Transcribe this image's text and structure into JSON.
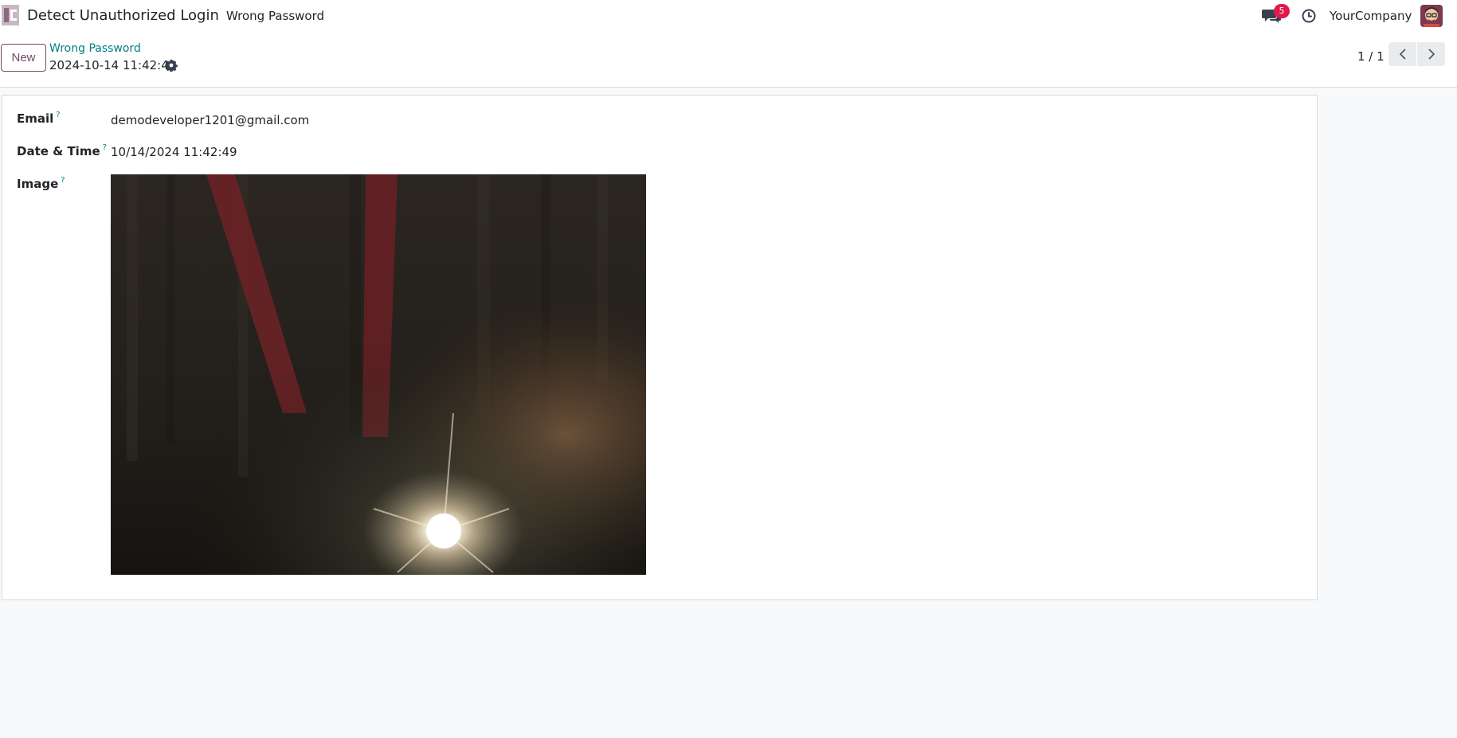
{
  "navbar": {
    "app_title": "Detect Unauthorized Login",
    "menu_item": "Wrong Password",
    "messages_count": "5",
    "company": "YourCompany"
  },
  "control": {
    "new_label": "New",
    "breadcrumb": "Wrong Password",
    "record_name": "2024-10-14 11:42:49",
    "pager_value": "1 / 1"
  },
  "form": {
    "email_label": "Email",
    "email_value": "demodeveloper1201@gmail.com",
    "datetime_label": "Date & Time",
    "datetime_value": "10/14/2024 11:42:49",
    "image_label": "Image",
    "help": "?"
  },
  "colors": {
    "brand": "#714b67",
    "link": "#017e84",
    "badge": "#e1194a"
  },
  "icons": [
    "app-icon",
    "chat-icon",
    "clock-icon",
    "gear-icon",
    "chevron-left-icon",
    "chevron-right-icon"
  ]
}
